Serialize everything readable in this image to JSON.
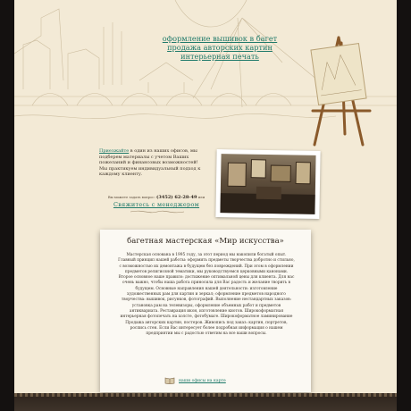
{
  "hero": {
    "links": [
      "оформление вышивок в багет",
      "продажа авторских картин",
      "интерьерная печать"
    ]
  },
  "info": {
    "link_text": "Приезжайте",
    "text": " в один из наших офисов, мы подберем материалы с учетом Ваших пожеланий и финансовых возможностей! Мы практикуем индивидуальный подход к каждому клиенту."
  },
  "phone": {
    "prefix": "Вы можете задать вопрос:",
    "number": "(3452) 62-28-49",
    "suffix": "или"
  },
  "contact_link": "Свяжитесь с менеджером",
  "about": {
    "title": "багетная мастерская «Мир искусства»",
    "text": "Мастерская основана в 1995 году, за этот период мы накопили богатый опыт. Главный принцип нашей работы: оформить предметы творчества добротно и стильно, с возможностью их демонтажа в будущем без повреждений. При этом в оформлении предметов религиозной тематики, мы руководствуемся церковными канонами. Второе основное наше правило: достижение оптимальной цены для клиента. Для нас очень важно, чтобы наша работа приносила для Вас радость и желание творить в будущем. Основные направления нашей деятельности: изготовление художественных рам для картин и зеркал; оформление предметов народного творчества: вышивок, рисунков, фотографий. Выполнение нестандартных заказов: установка рам на телевизоры, оформление объемных работ и предметов антиквариата. Реставрация икон, изготовление киотов. Широкоформатная интерьерная фотопечать на холсте, фотобумаге. Широкоформатное ламинирование Продажа авторских картин, постеров. Живопись под заказ: картин, портретов, роспись стен. Если Вас интересует более подробная информация о нашем предприятии мы с радостью ответим на все ваши вопросы.",
    "offices_link": "наши офисы на карте"
  }
}
